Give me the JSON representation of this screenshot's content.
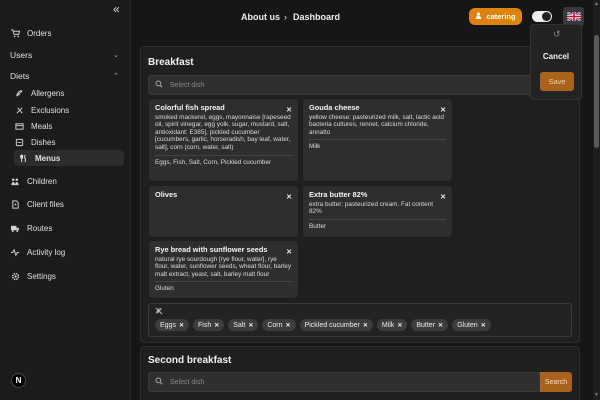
{
  "sidebar": {
    "items": [
      {
        "label": "Orders",
        "icon": "cart-icon"
      },
      {
        "label": "Users"
      },
      {
        "label": "Diets"
      },
      {
        "label": "Allergens",
        "icon": "allergen-icon"
      },
      {
        "label": "Exclusions",
        "icon": "exclusion-icon"
      },
      {
        "label": "Meals",
        "icon": "meals-icon"
      },
      {
        "label": "Dishes",
        "icon": "dishes-icon"
      },
      {
        "label": "Menus",
        "icon": "cutlery-icon",
        "active": true
      },
      {
        "label": "Children",
        "icon": "children-icon"
      },
      {
        "label": "Client files",
        "icon": "client-files-icon"
      },
      {
        "label": "Routes",
        "icon": "truck-icon"
      },
      {
        "label": "Activity log",
        "icon": "activity-icon"
      },
      {
        "label": "Settings",
        "icon": "gear-icon"
      }
    ],
    "logo_letter": "N"
  },
  "header": {
    "breadcrumb": [
      "About us",
      "Dashboard"
    ],
    "catering_label": "catering",
    "language_flag": "uk-flag-icon"
  },
  "popover": {
    "cancel_label": "Cancel",
    "save_label": "Save"
  },
  "breakfast": {
    "title": "Breakfast",
    "search_placeholder": "Select dish",
    "dishes": [
      {
        "name": "Colorful fish spread",
        "ingredients": "smoked mackerel, eggs, mayonnaise [rapeseed oil, spirit vinegar, egg yolk, sugar, mustard, salt, antioxidant: E385], pickled cucumber [cucumbers, garlic, horseradish, bay leaf, water, salt], corn (corn, water, salt)",
        "allergens": "Eggs, Fish, Salt, Corn, Pickled cucumber"
      },
      {
        "name": "Gouda cheese",
        "ingredients": "yellow cheese: pasteurized milk, salt, lactic acid bacteria cultures, rennet, calcium chloride, annatto",
        "allergens": "Milk"
      },
      {
        "name": "Olives",
        "ingredients": "",
        "allergens": ""
      },
      {
        "name": "Extra butter 82%",
        "ingredients": "extra butter: pasteurized cream. Fat content 82%",
        "allergens": "Butter"
      },
      {
        "name": "Rye bread with sunflower seeds",
        "ingredients": "natural rye sourdough [rye flour, water], rye flour, water, sunflower seeds, wheat flour, barley malt extract, yeast, salt, barley malt flour",
        "allergens": "Gluten"
      }
    ],
    "allergen_chips": [
      "Eggs",
      "Fish",
      "Salt",
      "Corn",
      "Pickled cucumber",
      "Milk",
      "Butter",
      "Gluten"
    ]
  },
  "second_breakfast": {
    "title": "Second breakfast",
    "search_placeholder": "Select dish",
    "search_button": "Search"
  },
  "colors": {
    "accent": "#e0820f",
    "save": "#a9631d",
    "background": "#161616",
    "card": "#2e2e2e"
  }
}
